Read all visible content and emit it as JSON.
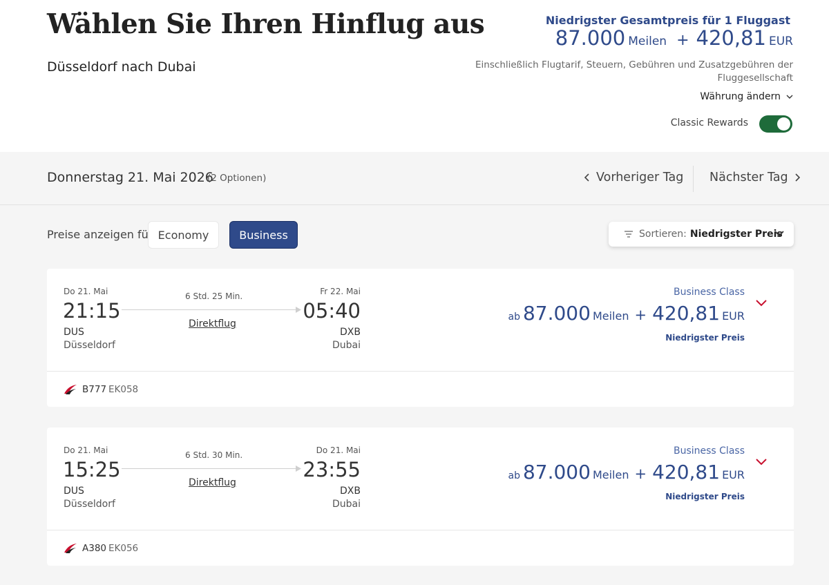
{
  "header": {
    "title": "Wählen Sie Ihren Hinflug aus",
    "route": "Düsseldorf nach Dubai",
    "summary_label": "Niedrigster Gesamtpreis für 1 Fluggast",
    "summary_miles": "87.000",
    "summary_miles_unit": "Meilen",
    "summary_plus": "+",
    "summary_amount": "420,81",
    "summary_currency": "EUR",
    "summary_note": "Einschließlich Flugtarif, Steuern, Gebühren und Zusatzgebühren der Fluggesellschaft",
    "currency_change": "Währung ändern",
    "classic_rewards_label": "Classic Rewards",
    "classic_rewards_on": true
  },
  "daybar": {
    "date": "Donnerstag 21. Mai 2026",
    "options": "(2 Optionen)",
    "prev": "Vorheriger Tag",
    "next": "Nächster Tag"
  },
  "filters": {
    "prices_label": "Preise anzeigen für:",
    "economy": "Economy",
    "business": "Business",
    "selected": "Business",
    "sort_label": "Sortieren:",
    "sort_value": "Niedrigster Preis"
  },
  "flights": [
    {
      "dep_date": "Do 21. Mai",
      "dep_time": "21:15",
      "dep_code": "DUS",
      "dep_city": "Düsseldorf",
      "duration": "6 Std. 25 Min.",
      "stops": "Direktflug",
      "arr_date": "Fr 22. Mai",
      "arr_time": "05:40",
      "arr_code": "DXB",
      "arr_city": "Dubai",
      "cabin": "Business Class",
      "price_prefix": "ab",
      "miles": "87.000",
      "miles_unit": "Meilen",
      "plus": "+",
      "amount": "420,81",
      "currency": "EUR",
      "tag": "Niedrigster Preis",
      "aircraft": "B777",
      "flight_no": "EK058"
    },
    {
      "dep_date": "Do 21. Mai",
      "dep_time": "15:25",
      "dep_code": "DUS",
      "dep_city": "Düsseldorf",
      "duration": "6 Std. 30 Min.",
      "stops": "Direktflug",
      "arr_date": "Do 21. Mai",
      "arr_time": "23:55",
      "arr_code": "DXB",
      "arr_city": "Dubai",
      "cabin": "Business Class",
      "price_prefix": "ab",
      "miles": "87.000",
      "miles_unit": "Meilen",
      "plus": "+",
      "amount": "420,81",
      "currency": "EUR",
      "tag": "Niedrigster Preis",
      "aircraft": "A380",
      "flight_no": "EK056"
    }
  ],
  "colors": {
    "brand_blue": "#2f4a8a",
    "toggle_green": "#1e6b3a",
    "expand_red": "#c8102e"
  },
  "icons": [
    "chevron-down-icon",
    "chevron-left-icon",
    "chevron-right-icon",
    "sort-icon",
    "arrow-right-icon",
    "airline-logo-icon"
  ]
}
